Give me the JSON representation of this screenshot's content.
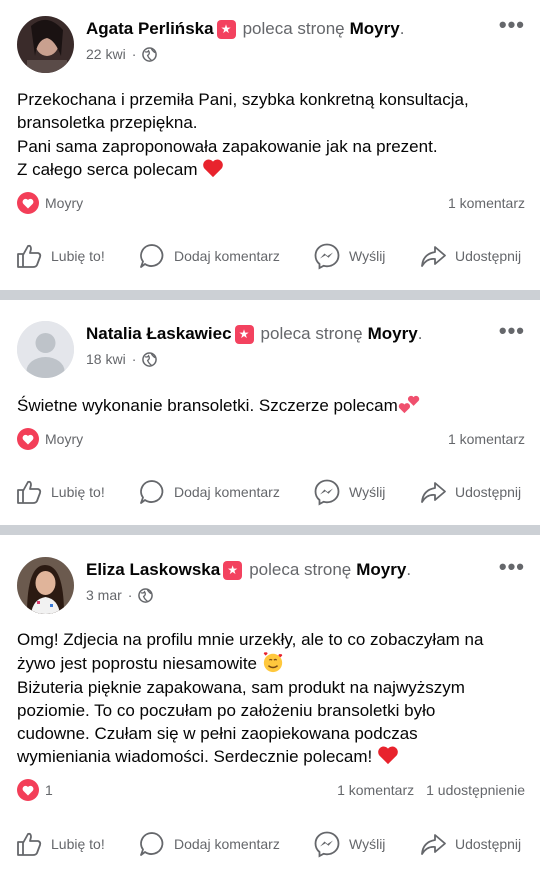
{
  "posts": [
    {
      "author": "Agata Perlińska",
      "recommends": "poleca stronę",
      "page": "Moyry",
      "date": "22 kwi",
      "lines": [
        "Przekochana i przemiła Pani, szybka konkretną konsultacja,",
        "bransoletka przepiękna.",
        "Pani sama zaproponowała zapakowanie jak na prezent.",
        "Z całego serca polecam"
      ],
      "reaction_label": "Moyry",
      "comments": "1 komentarz",
      "shares": ""
    },
    {
      "author": "Natalia Łaskawiec",
      "recommends": "poleca stronę",
      "page": "Moyry",
      "date": "18 kwi",
      "lines": [
        "Świetne wykonanie bransoletki. Szczerze polecam"
      ],
      "reaction_label": "Moyry",
      "comments": "1 komentarz",
      "shares": ""
    },
    {
      "author": "Eliza Laskowska",
      "recommends": "poleca stronę",
      "page": "Moyry",
      "date": "3 mar",
      "lines": [
        "Omg! Zdjecia na profilu mnie urzekły, ale to co zobaczyłam na",
        "żywo jest poprostu niesamowite",
        "Biżuteria pięknie zapakowana, sam produkt na najwyższym",
        "poziomie. To co poczułam po założeniu bransoletki było",
        "cudowne. Czułam się w pełni zaopiekowana podczas",
        "wymieniania wiadomości. Serdecznie polecam!"
      ],
      "reaction_label": "1",
      "comments": "1 komentarz",
      "shares": "1 udostępnienie"
    }
  ],
  "actions": {
    "like": "Lubię to!",
    "comment": "Dodaj komentarz",
    "send": "Wyślij",
    "share": "Udostępnij"
  },
  "icons": {
    "more": "more-horizontal-icon",
    "globe": "globe-icon",
    "recommend": "recommend-badge-icon",
    "heart": "heart-reaction-icon"
  },
  "colors": {
    "accent_red": "#f33e58",
    "meta_gray": "#65676b",
    "separator": "#ccd0d5"
  }
}
